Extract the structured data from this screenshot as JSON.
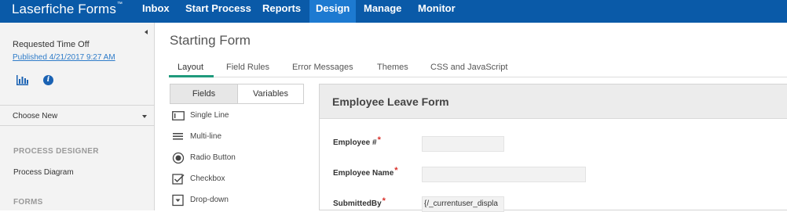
{
  "app": {
    "brand": "Laserfiche Forms",
    "brand_mark": "™"
  },
  "nav": [
    {
      "label": "Inbox"
    },
    {
      "label": "Start Process"
    },
    {
      "label": "Reports"
    },
    {
      "label": "Design",
      "active": true
    },
    {
      "label": "Manage"
    },
    {
      "label": "Monitor"
    }
  ],
  "sidebar": {
    "process_title": "Requested Time Off",
    "published": "Published 4/21/2017 9:27 AM",
    "choose_new": "Choose New",
    "process_designer_heading": "PROCESS DESIGNER",
    "process_diagram": "Process Diagram",
    "forms_heading": "FORMS"
  },
  "main": {
    "title": "Starting Form",
    "tabs": [
      {
        "label": "Layout",
        "active": true
      },
      {
        "label": "Field Rules"
      },
      {
        "label": "Error Messages"
      },
      {
        "label": "Themes"
      },
      {
        "label": "CSS and JavaScript"
      }
    ],
    "toggle": {
      "fields": "Fields",
      "variables": "Variables"
    },
    "palette": [
      {
        "label": "Single Line",
        "icon": "single-line-icon"
      },
      {
        "label": "Multi-line",
        "icon": "multi-line-icon"
      },
      {
        "label": "Radio Button",
        "icon": "radio-button-icon"
      },
      {
        "label": "Checkbox",
        "icon": "checkbox-icon"
      },
      {
        "label": "Drop-down",
        "icon": "dropdown-icon"
      }
    ]
  },
  "form": {
    "title": "Employee Leave Form",
    "required_mark": "*",
    "fields": [
      {
        "label": "Employee #",
        "value": ""
      },
      {
        "label": "Employee Name",
        "value": ""
      },
      {
        "label": "SubmittedBy",
        "value": "{/_currentuser_displa"
      }
    ]
  },
  "colors": {
    "topbar": "#0a5aa8",
    "nav_active": "#1d7ad1",
    "tab_underline": "#1f9a7c",
    "required": "#d9302a",
    "link": "#2f7cc9"
  }
}
